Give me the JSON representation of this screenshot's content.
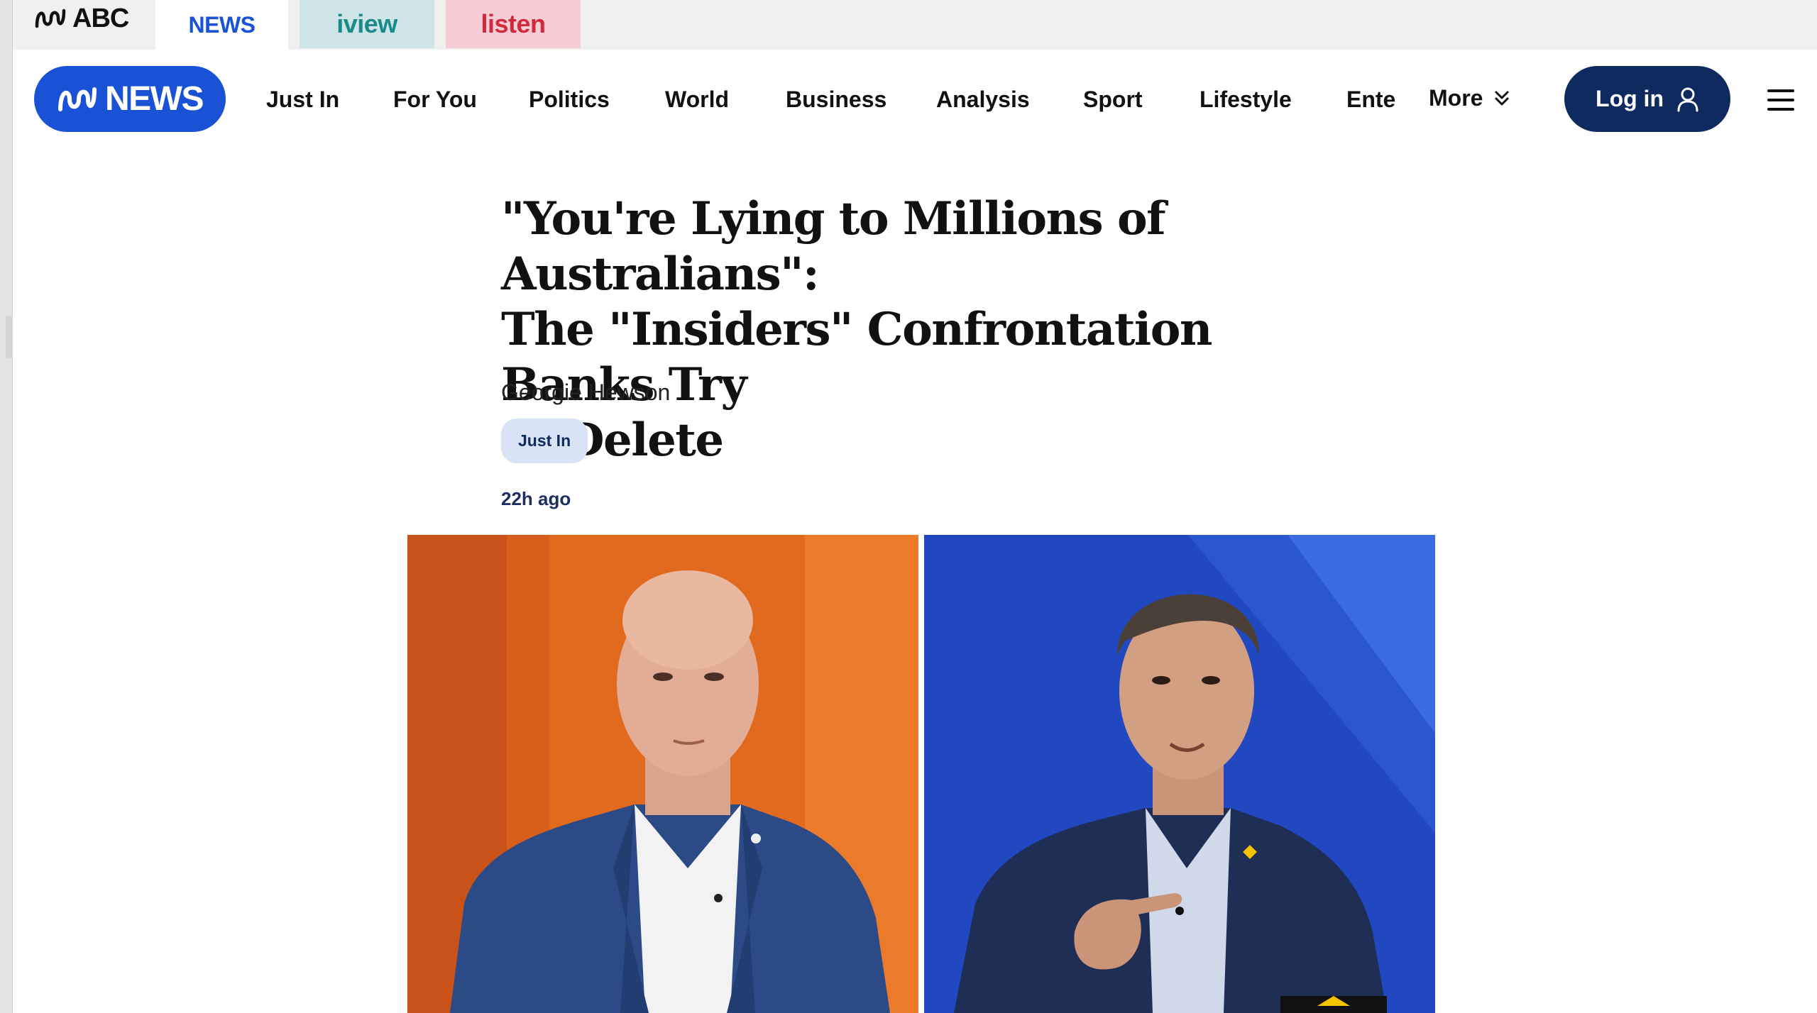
{
  "platform_bar": {
    "logo_text": "ABC",
    "tabs": [
      {
        "label": "NEWS",
        "active": true
      },
      {
        "label": "iview",
        "active": false
      },
      {
        "label": "listen",
        "active": false
      }
    ]
  },
  "header": {
    "logo_text": "NEWS",
    "nav": [
      "Just In",
      "For You",
      "Politics",
      "World",
      "Business",
      "Analysis",
      "Sport",
      "Lifestyle",
      "Ente"
    ],
    "more_label": "More",
    "login_label": "Log in"
  },
  "article": {
    "headline_lines": [
      "\"You're Lying to Millions of Australians\":",
      "The \"Insiders\" Confrontation Banks Try",
      "to Delete"
    ],
    "author": "Georgie Hewson",
    "tag": "Just In",
    "published": "22h ago"
  },
  "colors": {
    "brand_blue": "#1a52d6",
    "navy": "#0e2a5e",
    "iview_bg": "#cfe4e6",
    "listen_bg": "#f6cdd5",
    "tag_bg": "#d9e3f6",
    "hero_left_bg": "#e26a1e",
    "hero_right_bg": "#2148c0"
  },
  "icons": {
    "more": "double-chevron-down-icon",
    "login": "user-icon",
    "menu": "hamburger-menu-icon",
    "logo": "abc-lissajous-icon"
  }
}
